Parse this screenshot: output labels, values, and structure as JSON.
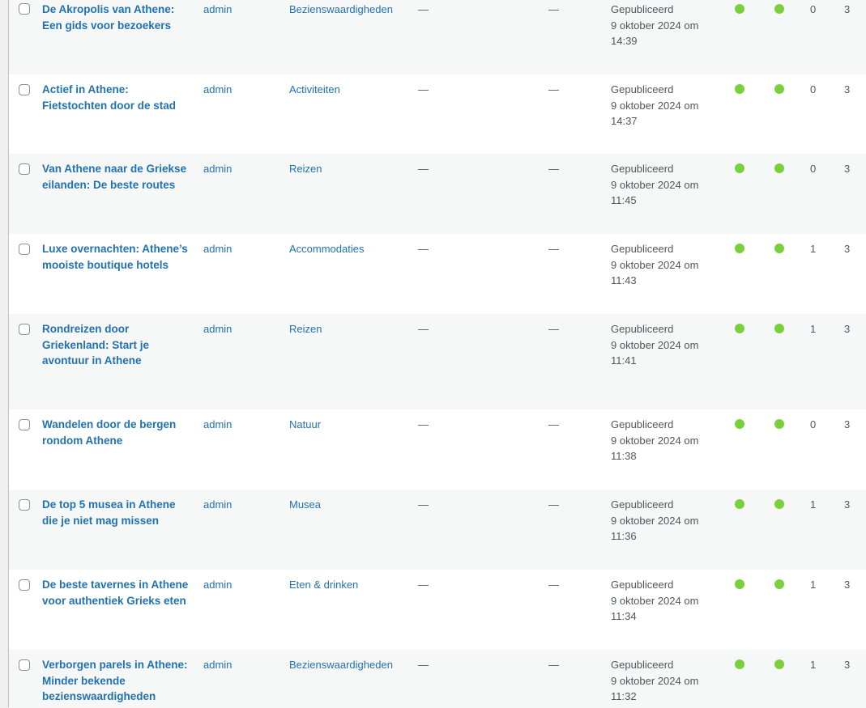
{
  "colors": {
    "link": "#2271b1",
    "seo_status_good": "#7ad03a",
    "readability_good": "#7ad03a"
  },
  "rows": [
    {
      "title": "De Akropolis van Athene: Een gids voor bezoekers",
      "author": "admin",
      "category": "Bezienswaardigheden",
      "tags": "—",
      "comments": "—",
      "status": "Gepubliceerd",
      "date": "9 oktober 2024 om 14:39",
      "seo": "good",
      "readability": "good",
      "inlinks": "0",
      "outlinks": "3"
    },
    {
      "title": "Actief in Athene: Fietstochten door de stad",
      "author": "admin",
      "category": "Activiteiten",
      "tags": "—",
      "comments": "—",
      "status": "Gepubliceerd",
      "date": "9 oktober 2024 om 14:37",
      "seo": "good",
      "readability": "good",
      "inlinks": "0",
      "outlinks": "3"
    },
    {
      "title": "Van Athene naar de Griekse eilanden: De beste routes",
      "author": "admin",
      "category": "Reizen",
      "tags": "—",
      "comments": "—",
      "status": "Gepubliceerd",
      "date": "9 oktober 2024 om 11:45",
      "seo": "good",
      "readability": "good",
      "inlinks": "0",
      "outlinks": "3"
    },
    {
      "title": "Luxe overnachten: Athene’s mooiste boutique hotels",
      "author": "admin",
      "category": "Accommodaties",
      "tags": "—",
      "comments": "—",
      "status": "Gepubliceerd",
      "date": "9 oktober 2024 om 11:43",
      "seo": "good",
      "readability": "good",
      "inlinks": "1",
      "outlinks": "3"
    },
    {
      "title": "Rondreizen door Griekenland: Start je avontuur in Athene",
      "author": "admin",
      "category": "Reizen",
      "tags": "—",
      "comments": "—",
      "status": "Gepubliceerd",
      "date": "9 oktober 2024 om 11:41",
      "seo": "good",
      "readability": "good",
      "inlinks": "1",
      "outlinks": "3"
    },
    {
      "title": "Wandelen door de bergen rondom Athene",
      "author": "admin",
      "category": "Natuur",
      "tags": "—",
      "comments": "—",
      "status": "Gepubliceerd",
      "date": "9 oktober 2024 om 11:38",
      "seo": "good",
      "readability": "good",
      "inlinks": "0",
      "outlinks": "3"
    },
    {
      "title": "De top 5 musea in Athene die je niet mag missen",
      "author": "admin",
      "category": "Musea",
      "tags": "—",
      "comments": "—",
      "status": "Gepubliceerd",
      "date": "9 oktober 2024 om 11:36",
      "seo": "good",
      "readability": "good",
      "inlinks": "1",
      "outlinks": "3"
    },
    {
      "title": "De beste tavernes in Athene voor authentiek Grieks eten",
      "author": "admin",
      "category": "Eten & drinken",
      "tags": "—",
      "comments": "—",
      "status": "Gepubliceerd",
      "date": "9 oktober 2024 om 11:34",
      "seo": "good",
      "readability": "good",
      "inlinks": "1",
      "outlinks": "3"
    },
    {
      "title": "Verborgen parels in Athene: Minder bekende bezienswaardigheden",
      "author": "admin",
      "category": "Bezienswaardigheden",
      "tags": "—",
      "comments": "—",
      "status": "Gepubliceerd",
      "date": "9 oktober 2024 om 11:32",
      "seo": "good",
      "readability": "good",
      "inlinks": "1",
      "outlinks": "3"
    }
  ]
}
